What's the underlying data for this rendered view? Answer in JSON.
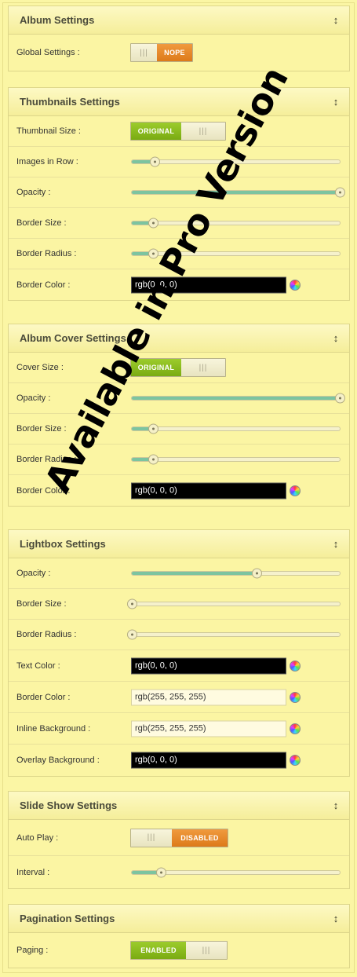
{
  "watermark": "Available in Pro Version",
  "album": {
    "title": "Album Settings",
    "toggle": "↕",
    "global_label": "Global Settings :",
    "global_switch": {
      "knob": "|||",
      "state": "NOPE"
    }
  },
  "thumbnails": {
    "title": "Thumbnails Settings",
    "toggle": "↕",
    "size_label": "Thumbnail Size :",
    "size_switch": {
      "state": "ORIGINAL",
      "knob": "|||"
    },
    "images_row_label": "Images in Row :",
    "images_row_value": 0.11,
    "opacity_label": "Opacity :",
    "opacity_value": 1.0,
    "border_size_label": "Border Size :",
    "border_size_value": 0.1,
    "border_radius_label": "Border Radius :",
    "border_radius_value": 0.1,
    "border_color_label": "Border Color :",
    "border_color_value": "rgb(0, 0, 0)"
  },
  "album_cover": {
    "title": "Album Cover Settings",
    "toggle": "↕",
    "size_label": "Cover Size :",
    "size_switch": {
      "state": "ORIGINAL",
      "knob": "|||"
    },
    "opacity_label": "Opacity :",
    "opacity_value": 1.0,
    "border_size_label": "Border Size :",
    "border_size_value": 0.1,
    "border_radius_label": "Border Radius :",
    "border_radius_value": 0.1,
    "border_color_label": "Border Color :",
    "border_color_value": "rgb(0, 0, 0)"
  },
  "lightbox": {
    "title": "Lightbox Settings",
    "toggle": "↕",
    "opacity_label": "Opacity :",
    "opacity_value": 0.6,
    "border_size_label": "Border Size :",
    "border_size_value": 0.0,
    "border_radius_label": "Border Radius :",
    "border_radius_value": 0.0,
    "text_color_label": "Text Color :",
    "text_color_value": "rgb(0, 0, 0)",
    "border_color_label": "Border Color :",
    "border_color_value": "rgb(255, 255, 255)",
    "inline_bg_label": "Inline Background :",
    "inline_bg_value": "rgb(255, 255, 255)",
    "overlay_bg_label": "Overlay Background :",
    "overlay_bg_value": "rgb(0, 0, 0)"
  },
  "slideshow": {
    "title": "Slide Show Settings",
    "toggle": "↕",
    "autoplay_label": "Auto Play :",
    "autoplay_switch": {
      "knob": "|||",
      "state": "DISABLED"
    },
    "interval_label": "Interval :",
    "interval_value": 0.14
  },
  "pagination": {
    "title": "Pagination Settings",
    "toggle": "↕",
    "paging_label": "Paging :",
    "paging_switch": {
      "state": "ENABLED",
      "knob": "|||"
    }
  },
  "colors": {
    "background": "#fbf6a4",
    "switch_green": "#8cbd1f",
    "switch_orange": "#e88a2c",
    "slider_fill": "#7cc4a0"
  }
}
